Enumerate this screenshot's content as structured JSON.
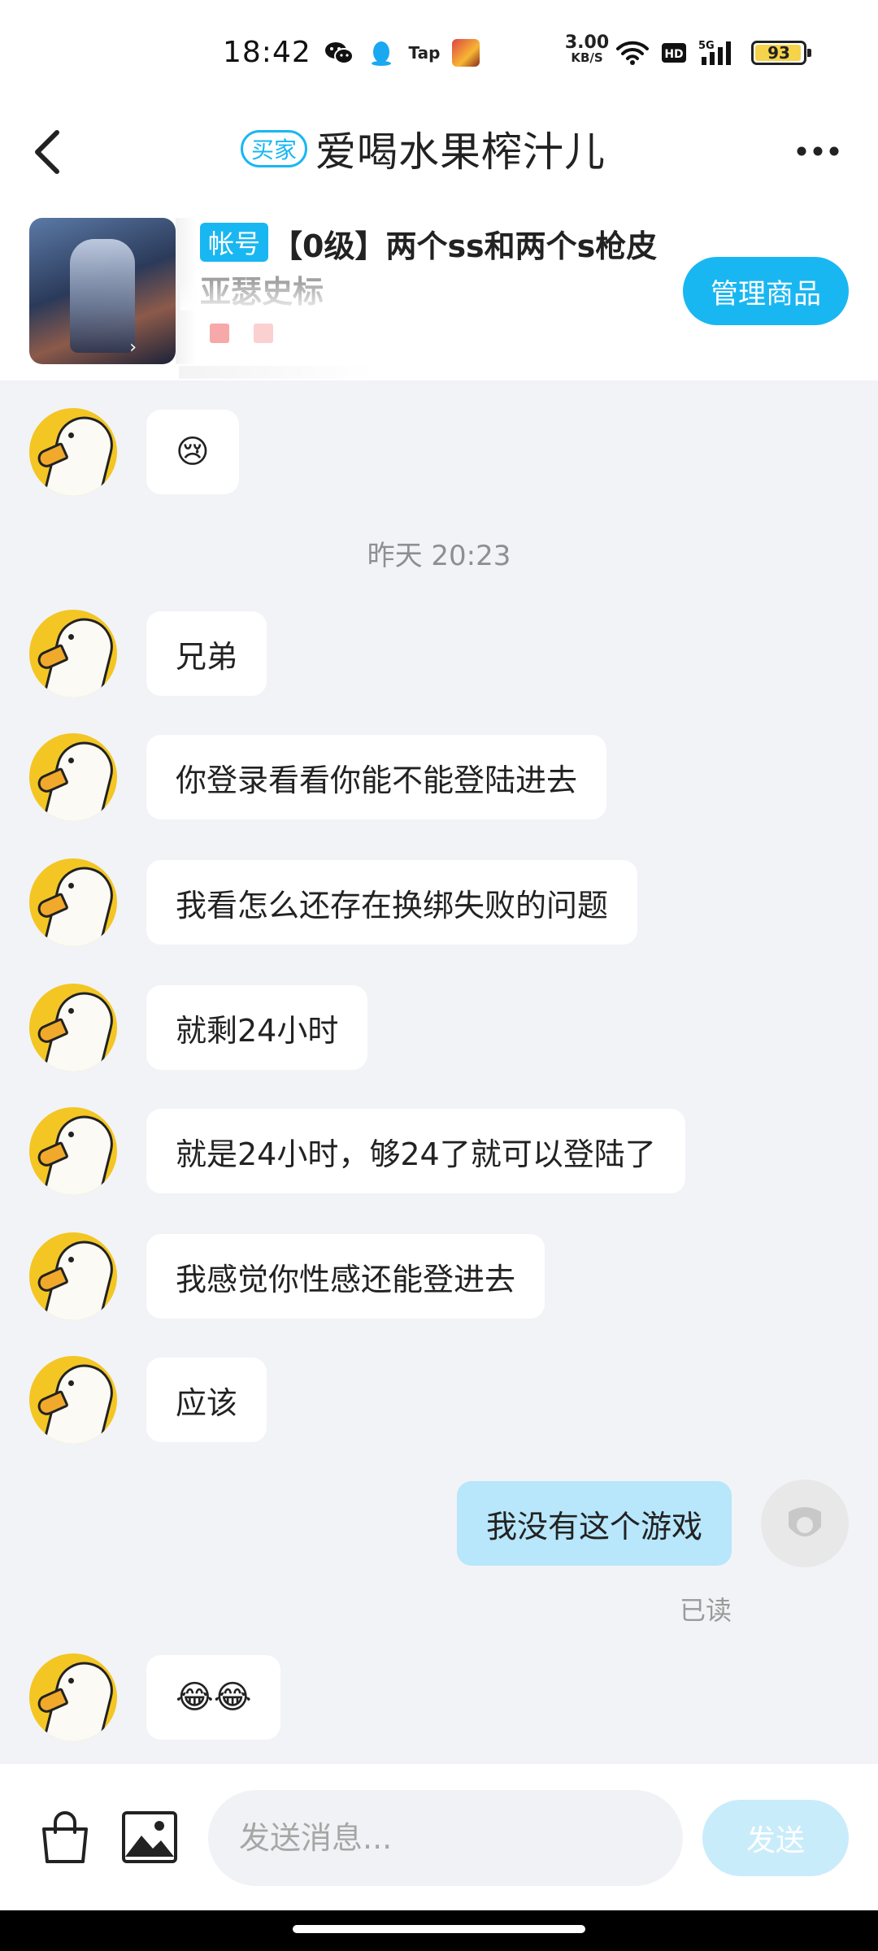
{
  "status_bar": {
    "time": "18:42",
    "icons": [
      "wechat-icon",
      "qq-icon",
      "taptap-icon",
      "game-icon",
      "wifi-icon",
      "hd-icon",
      "5g-signal-icon"
    ],
    "network_speed_value": "3.00",
    "network_speed_unit": "KB/S",
    "battery": "93",
    "tap_label": "Tap"
  },
  "header": {
    "role_tag": "买家",
    "title": "爱喝水果榨汁儿",
    "back_icon": "chevron-left-icon",
    "more_icon": "more-horizontal-icon"
  },
  "product": {
    "category_tag": "帐号",
    "title": "【0级】两个ss和两个s枪皮",
    "subtitle": "亚瑟史标",
    "manage_button": "管理商品"
  },
  "chat": {
    "messages": [
      {
        "from": "other",
        "text": "😢"
      },
      {
        "type": "time",
        "text": "昨天  20:23"
      },
      {
        "from": "other",
        "text": "兄弟"
      },
      {
        "from": "other",
        "text": "你登录看看你能不能登陆进去"
      },
      {
        "from": "other",
        "text": "我看怎么还存在换绑失败的问题"
      },
      {
        "from": "other",
        "text": "就剩24小时"
      },
      {
        "from": "other",
        "text": "就是24小时，够24了就可以登陆了"
      },
      {
        "from": "other",
        "text": "我感觉你性感还能登进去"
      },
      {
        "from": "other",
        "text": "应该"
      },
      {
        "from": "me",
        "text": "我没有这个游戏",
        "status": "已读"
      },
      {
        "from": "other",
        "text": "😂😂"
      }
    ]
  },
  "input_bar": {
    "placeholder": "发送消息...",
    "send_label": "发送",
    "bag_icon": "shopping-bag-icon",
    "image_icon": "image-icon"
  },
  "colors": {
    "accent": "#19b7f2",
    "outgoing_bubble": "#b8e6fb",
    "background": "#f2f3f7",
    "avatar": "#f3c623"
  }
}
